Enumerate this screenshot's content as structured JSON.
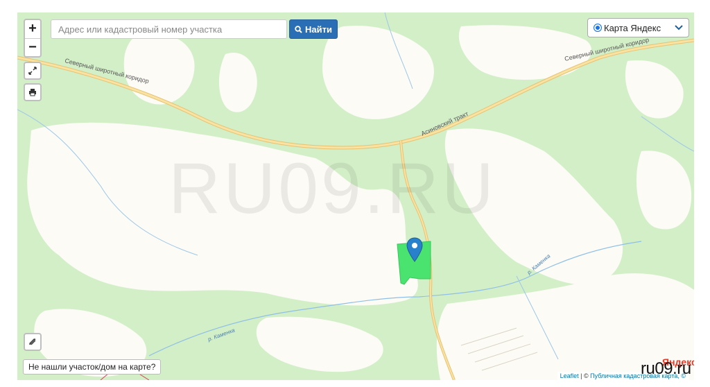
{
  "search": {
    "placeholder": "Адрес или кадастровый номер участка",
    "button_label": "Найти"
  },
  "zoom": {
    "in_label": "+",
    "out_label": "−"
  },
  "layer_select": {
    "selected": "Карта Яндекс"
  },
  "map_labels": {
    "road_north_left": "Северный широтный коридор",
    "road_north_right": "Северный широтный коридор",
    "road_tract": "Асиновский тракт",
    "river_1": "р. Каменка",
    "river_2": "р. Каменка"
  },
  "watermark": "RU09.RU",
  "not_found_button": "Не нашли участок/дом на карте?",
  "attribution": {
    "leaflet": "Leaflet",
    "sep": " | © ",
    "pkk": "Публичная кадастровая карта, ©"
  },
  "yandex_logo": "Яндекс",
  "corner_brand": "ru09.ru",
  "colors": {
    "forest": "#d3efc8",
    "field": "#fcfbf6",
    "road": "#f4d27a",
    "parcel": "#4be36f",
    "marker": "#2a81cb",
    "button": "#2a6eb6"
  }
}
